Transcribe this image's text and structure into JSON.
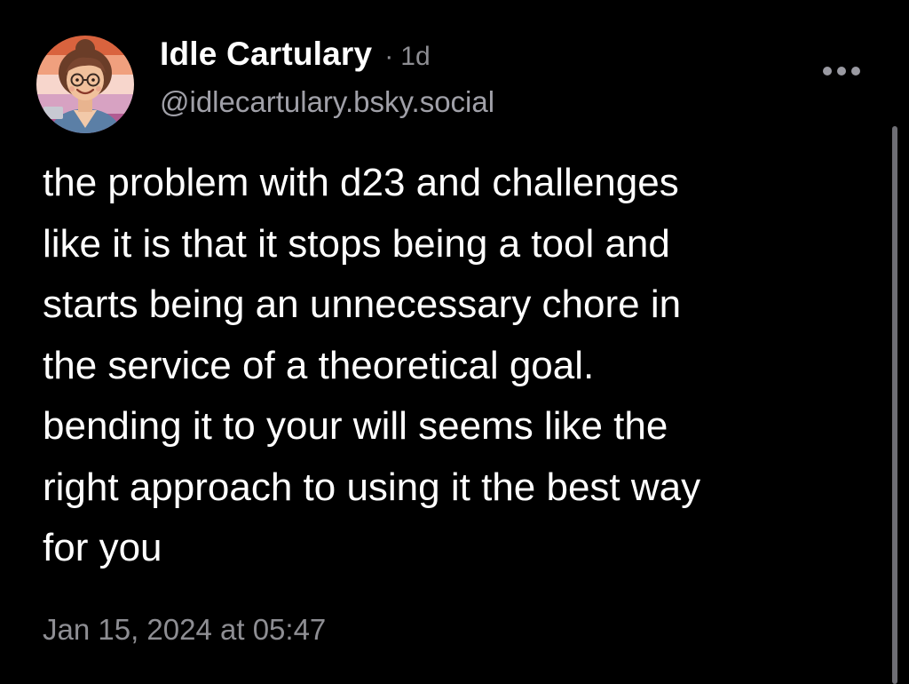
{
  "post": {
    "author": {
      "display_name": "Idle Cartulary",
      "handle": "@idlecartulary.bsky.social",
      "avatar_icon": "avatar-illustration-icon"
    },
    "separator": "·",
    "relative_time": "1d",
    "text": "the problem with d23 and challenges\nlike it is that it stops being a tool and\nstarts being an unnecessary chore in\nthe service of a theoretical goal.\nbending it to your will seems like the\nright approach to using it the best way\nfor you",
    "timestamp": "Jan 15, 2024 at 05:47",
    "more_icon": "ellipsis-icon"
  },
  "colors": {
    "background": "#000000",
    "text_primary": "#ffffff",
    "text_secondary": "#8e8e93",
    "avatar_stripes": [
      "#d9633e",
      "#f0a07e",
      "#f7d6cc",
      "#d7a2c2",
      "#b15b92"
    ]
  }
}
